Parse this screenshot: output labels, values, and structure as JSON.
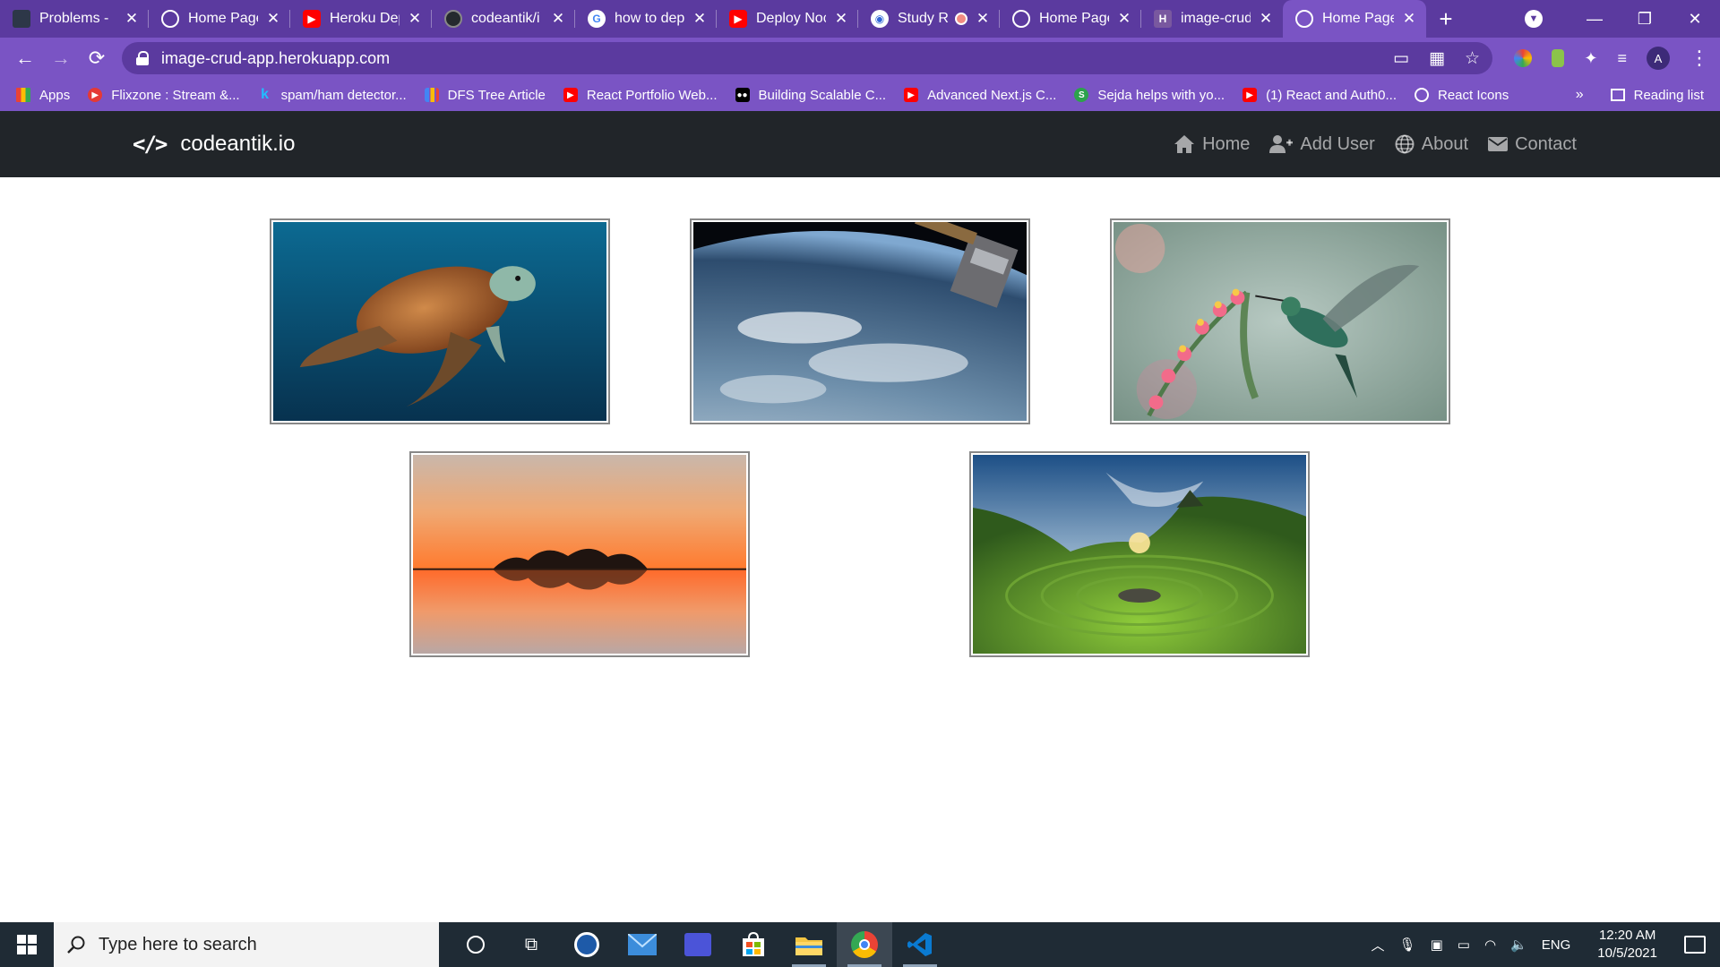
{
  "browser": {
    "tabs": [
      {
        "title": "Problems - ",
        "icon": "task-icon",
        "color": "#2d3748",
        "active": false
      },
      {
        "title": "Home Page",
        "icon": "globe-icon",
        "color": "#ffffff",
        "active": false
      },
      {
        "title": "Heroku Dep",
        "icon": "youtube-icon",
        "color": "#ff0000",
        "active": false
      },
      {
        "title": "codeantik/i",
        "icon": "github-icon",
        "color": "#24292e",
        "active": false
      },
      {
        "title": "how to dep",
        "icon": "google-icon",
        "color": "#ffffff",
        "active": false
      },
      {
        "title": "Deploy Noc",
        "icon": "youtube-icon",
        "color": "#ff0000",
        "active": false
      },
      {
        "title": "Study R",
        "icon": "study-icon",
        "color": "#ffffff",
        "active": false
      },
      {
        "title": "Home Page",
        "icon": "globe-icon",
        "color": "#ffffff",
        "active": false
      },
      {
        "title": "image-crud",
        "icon": "heroku-icon",
        "color": "#79589f",
        "active": false
      },
      {
        "title": "Home Page",
        "icon": "globe-icon",
        "color": "#ffffff",
        "active": true
      }
    ],
    "url": "image-crud-app.herokuapp.com",
    "profile_initial": "A",
    "bookmarks": [
      {
        "label": "Apps",
        "icon": "apps-grid-icon",
        "color": "#e94235"
      },
      {
        "label": "Flixzone : Stream &...",
        "icon": "flixzone-icon",
        "color": "#e53935"
      },
      {
        "label": "spam/ham detector...",
        "icon": "kaggle-icon",
        "color": "#20beff"
      },
      {
        "label": "DFS Tree Article",
        "icon": "chart-icon",
        "color": "#fbbc04"
      },
      {
        "label": "React Portfolio Web...",
        "icon": "youtube-icon",
        "color": "#ff0000"
      },
      {
        "label": "Building Scalable C...",
        "icon": "medium-icon",
        "color": "#000000"
      },
      {
        "label": "Advanced Next.js C...",
        "icon": "youtube-icon",
        "color": "#ff0000"
      },
      {
        "label": "Sejda helps with yo...",
        "icon": "sejda-icon",
        "color": "#2ca24c"
      },
      {
        "label": "(1) React and Auth0...",
        "icon": "youtube-icon",
        "color": "#ff0000"
      },
      {
        "label": "React Icons",
        "icon": "globe-icon",
        "color": "#ffffff"
      }
    ],
    "more_bookmarks": "»",
    "reading_list": "Reading list"
  },
  "site": {
    "brand": "codeantik.io",
    "brand_icon": "code-icon",
    "menu": [
      {
        "label": "Home",
        "icon": "home-icon"
      },
      {
        "label": "Add User",
        "icon": "user-plus-icon"
      },
      {
        "label": "About",
        "icon": "globe-icon"
      },
      {
        "label": "Contact",
        "icon": "envelope-icon"
      }
    ],
    "images": [
      {
        "name": "sea-turtle-image",
        "subject": "sea turtle"
      },
      {
        "name": "earth-from-space-image",
        "subject": "earth from space"
      },
      {
        "name": "hummingbird-image",
        "subject": "hummingbird"
      },
      {
        "name": "sunset-lake-image",
        "subject": "sunset lake"
      },
      {
        "name": "green-valley-image",
        "subject": "green valley"
      }
    ]
  },
  "taskbar": {
    "search_placeholder": "Type here to search",
    "language": "ENG",
    "time": "12:20 AM",
    "date": "10/5/2021"
  }
}
